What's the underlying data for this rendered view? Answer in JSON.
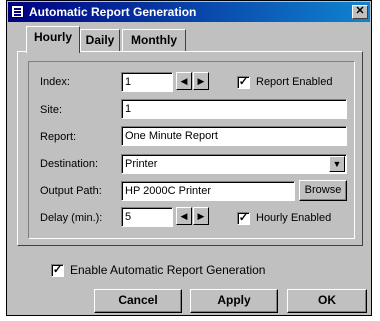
{
  "window": {
    "title": "Automatic Report Generation",
    "close_glyph": "✕"
  },
  "tabs": [
    {
      "label": "Hourly",
      "active": true
    },
    {
      "label": "Daily",
      "active": false
    },
    {
      "label": "Monthly",
      "active": false
    }
  ],
  "form": {
    "index_label": "Index:",
    "index_value": "1",
    "report_enabled_label": "Report Enabled",
    "report_enabled_checked": true,
    "site_label": "Site:",
    "site_value": "1",
    "report_label": "Report:",
    "report_value": "One Minute Report",
    "destination_label": "Destination:",
    "destination_value": "Printer",
    "output_path_label": "Output Path:",
    "output_path_value": "HP 2000C Printer",
    "browse_label": "Browse",
    "delay_label": "Delay (min.):",
    "delay_value": "5",
    "hourly_enabled_label": "Hourly Enabled",
    "hourly_enabled_checked": true
  },
  "enable_auto": {
    "label": "Enable Automatic Report Generation",
    "checked": true
  },
  "buttons": {
    "cancel": "Cancel",
    "apply": "Apply",
    "ok": "OK"
  },
  "glyphs": {
    "spin_left": "◀",
    "spin_right": "▶",
    "dropdown": "▼",
    "check": "✓"
  }
}
